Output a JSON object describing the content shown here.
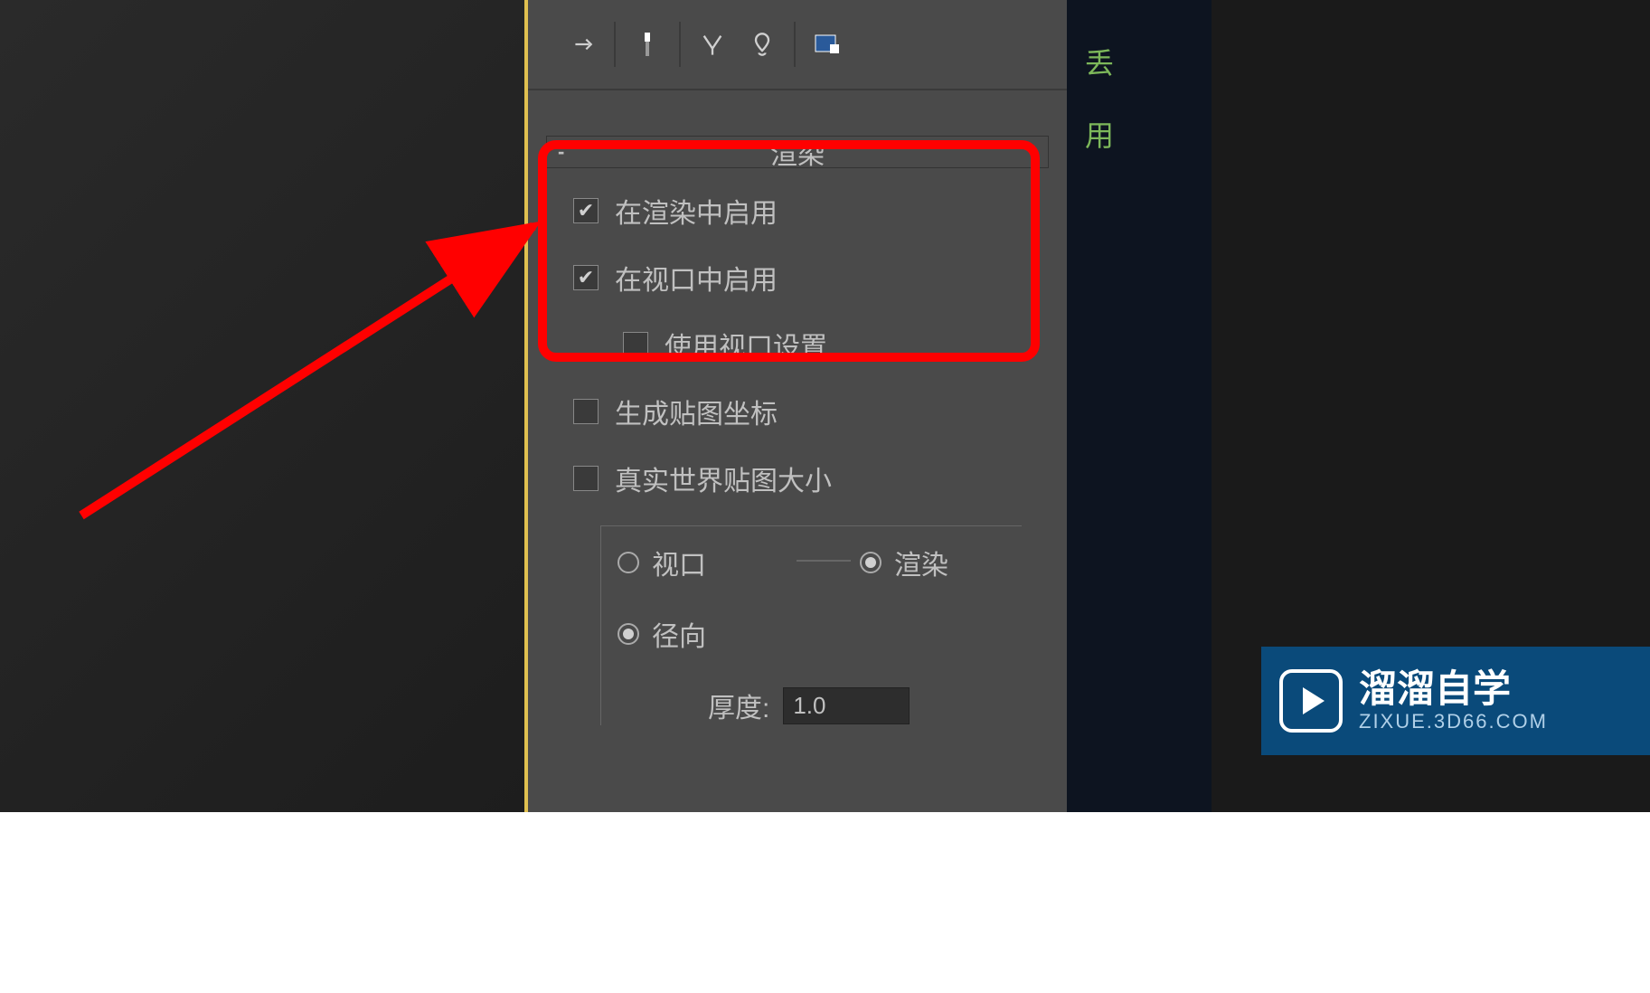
{
  "rightStrip": {
    "line1": "丢",
    "line2": "用"
  },
  "rollout": {
    "title": "渲染",
    "toggle": "-"
  },
  "checkboxes": {
    "enableInRender": {
      "label": "在渲染中启用",
      "checked": true
    },
    "enableInViewport": {
      "label": "在视口中启用",
      "checked": true
    },
    "useViewportSettings": {
      "label": "使用视口设置",
      "checked": false
    },
    "generateMappingCoords": {
      "label": "生成贴图坐标",
      "checked": false
    },
    "realWorldMapSize": {
      "label": "真实世界贴图大小",
      "checked": false
    }
  },
  "radios": {
    "viewport": {
      "label": "视口",
      "selected": false
    },
    "render": {
      "label": "渲染",
      "selected": true
    },
    "radial": {
      "label": "径向",
      "selected": true
    }
  },
  "spinner": {
    "thicknessLabel": "厚度:",
    "thicknessValue": "1.0"
  },
  "watermark": {
    "title": "溜溜自学",
    "url": "ZIXUE.3D66.COM"
  }
}
